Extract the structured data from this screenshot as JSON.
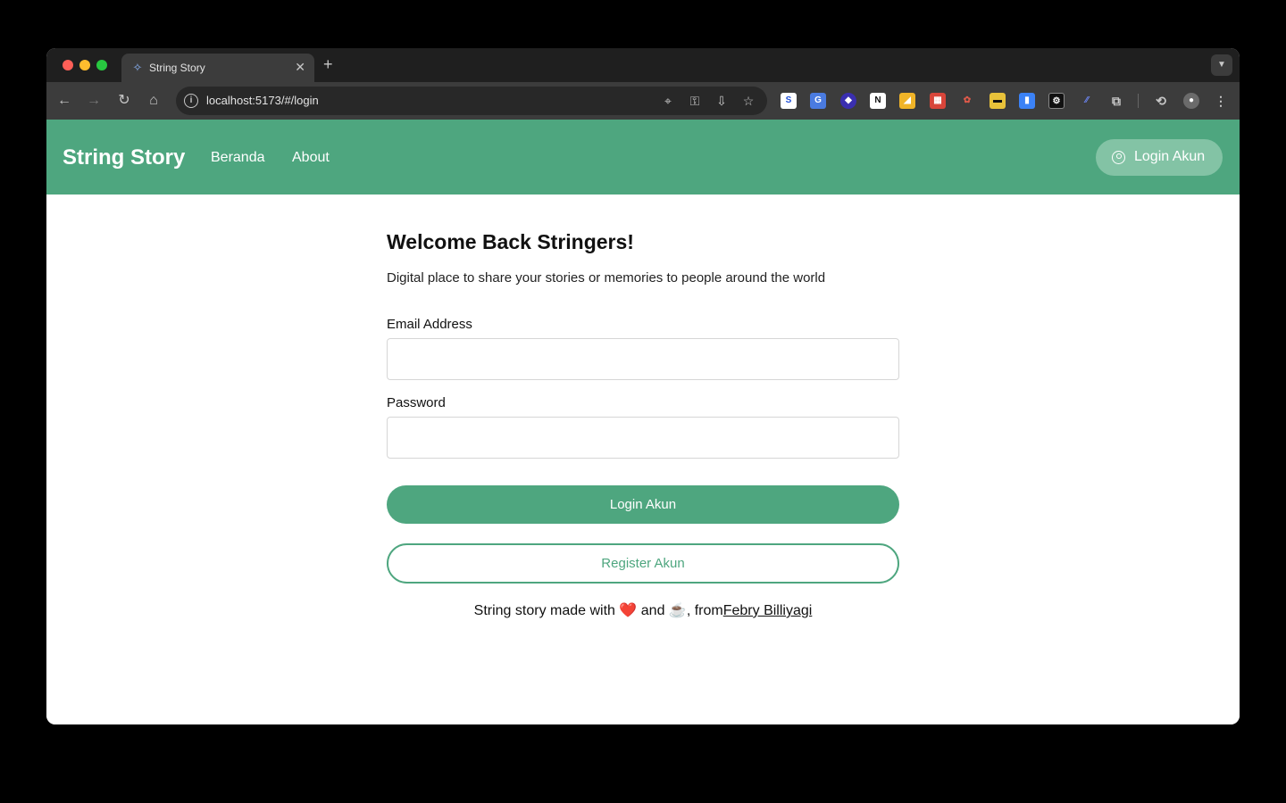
{
  "browser": {
    "tab_title": "String Story",
    "url": "localhost:5173/#/login",
    "new_tab_label": "+"
  },
  "navbar": {
    "brand": "String Story",
    "links": [
      "Beranda",
      "About"
    ],
    "login_label": "Login Akun",
    "color": "#4ea67f"
  },
  "login": {
    "title": "Welcome Back Stringers!",
    "subtitle": "Digital place to share your stories or memories to people around the world",
    "email_label": "Email Address",
    "email_value": "",
    "password_label": "Password",
    "password_value": "",
    "login_button": "Login Akun",
    "register_button": "Register Akun"
  },
  "footer": {
    "prefix": "String story made with",
    "heart": "❤️",
    "and": "and",
    "coffee": "☕",
    "from": ", from",
    "author": "Febry Billiyagi"
  },
  "icons": {
    "back": "arrow-left-icon",
    "forward": "arrow-right-icon",
    "reload": "reload-icon",
    "home": "home-icon",
    "info": "info-icon",
    "location": "location-icon",
    "password_key": "key-icon",
    "install": "install-icon",
    "bookmark": "star-icon",
    "extensions": "puzzle-icon",
    "menu": "kebab-menu-icon",
    "user": "user-circle-icon"
  }
}
